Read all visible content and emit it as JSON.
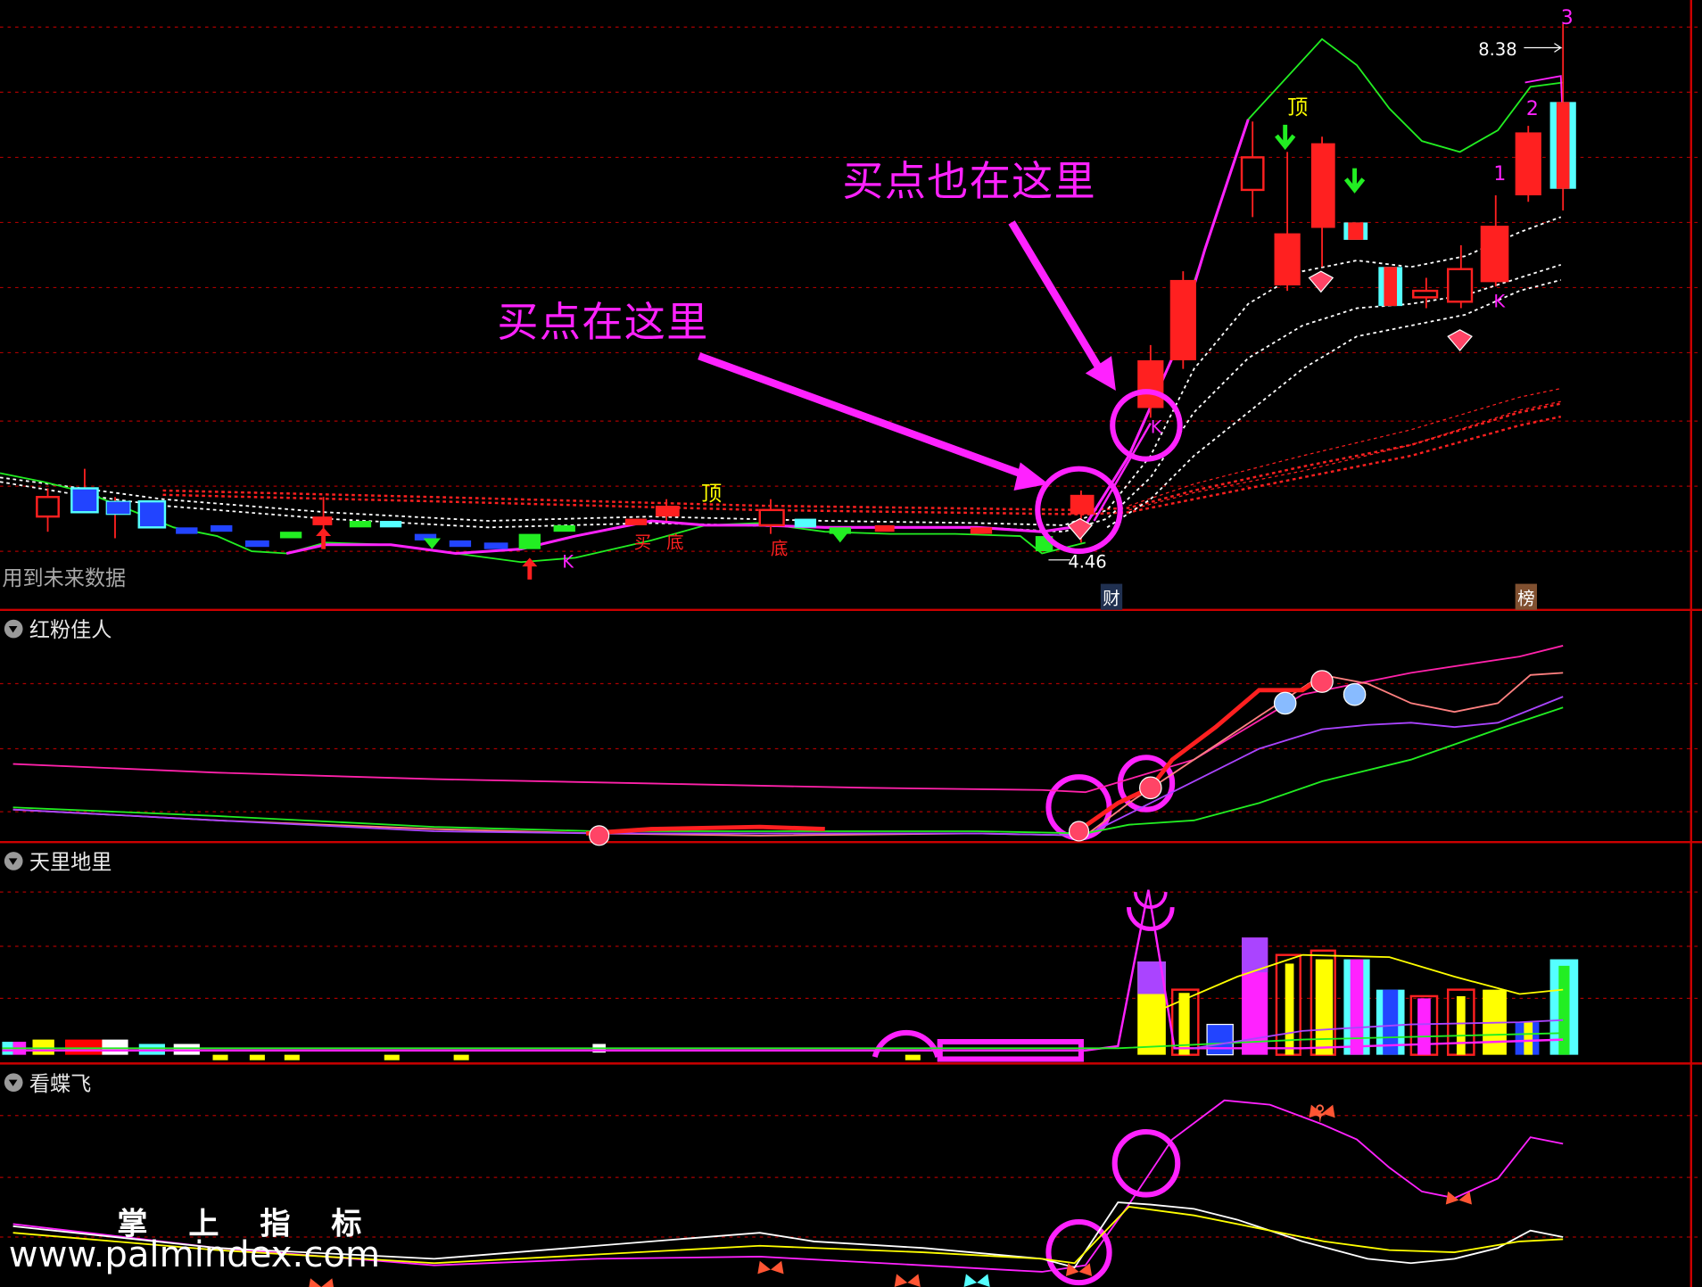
{
  "main_chart": {
    "future_data_label": "用到未来数据",
    "price_high_label": "8.38",
    "price_low_label": "4.46",
    "annotation_buy": "买点在这里",
    "annotation_buy_also": "买点也在这里",
    "top_label": "顶",
    "top_label_2": "顶",
    "wave_numbers": [
      "1",
      "2",
      "3"
    ],
    "k_labels": [
      "K",
      "K",
      "K"
    ],
    "buy_labels": [
      "买",
      "底",
      "底"
    ],
    "info_badge_cai": "财",
    "info_badge_bang": "榜"
  },
  "panels": [
    {
      "title": "红粉佳人"
    },
    {
      "title": "天里地里"
    },
    {
      "title": "看蝶飞"
    }
  ],
  "watermark": {
    "title": "掌 上 指 标",
    "url": "www.palmindex.com"
  },
  "colors": {
    "grid": "#aa0000",
    "up_candle": "#ff0000",
    "down_candle_blue": "#2244ff",
    "down_candle_cyan": "#55ffff",
    "annotation": "#ff22ff",
    "separator": "#cc0000"
  }
}
